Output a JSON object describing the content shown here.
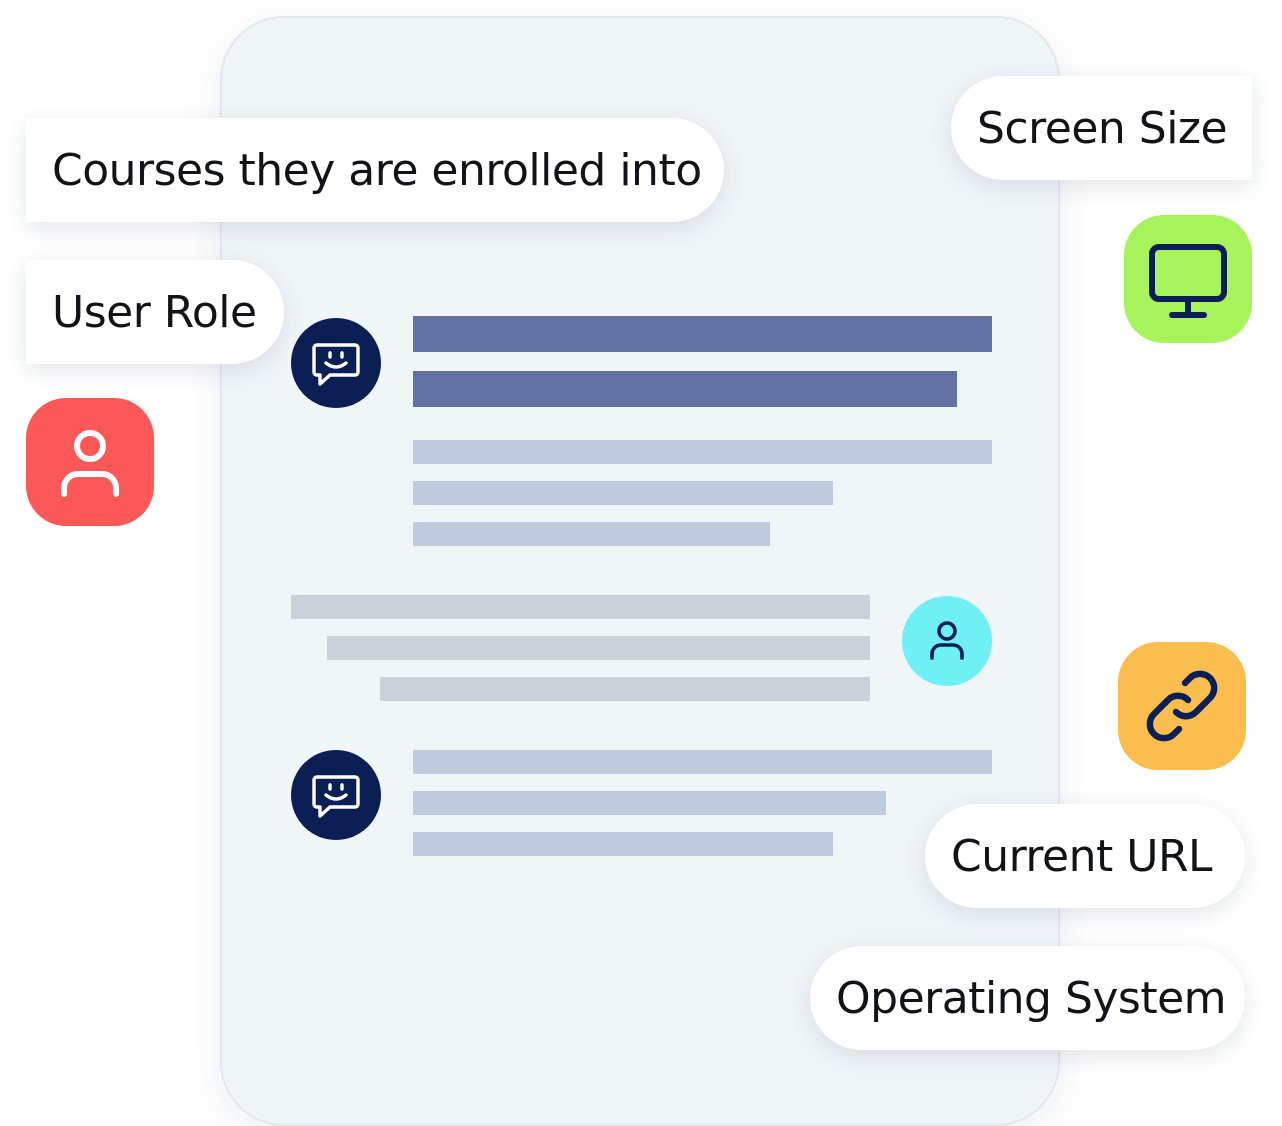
{
  "tags": {
    "courses": "Courses they are enrolled into",
    "user_role": "User Role",
    "screen_size": "Screen Size",
    "current_url": "Current URL",
    "operating_system": "Operating System"
  },
  "icons": {
    "user_tile": "user-icon",
    "monitor_tile": "monitor-icon",
    "link_tile": "link-icon",
    "bot_avatar": "chat-smile-icon",
    "user_avatar": "user-icon"
  },
  "colors": {
    "user_tile": "#fd5858",
    "monitor_tile": "#a7f35c",
    "link_tile": "#fbbd4e",
    "bot_avatar": "#0c1f55",
    "user_avatar": "#6ef0f5",
    "bar_dark": "#6271a1",
    "bar_light": "#bfcce0",
    "bar_gray": "#c9d1d9"
  }
}
